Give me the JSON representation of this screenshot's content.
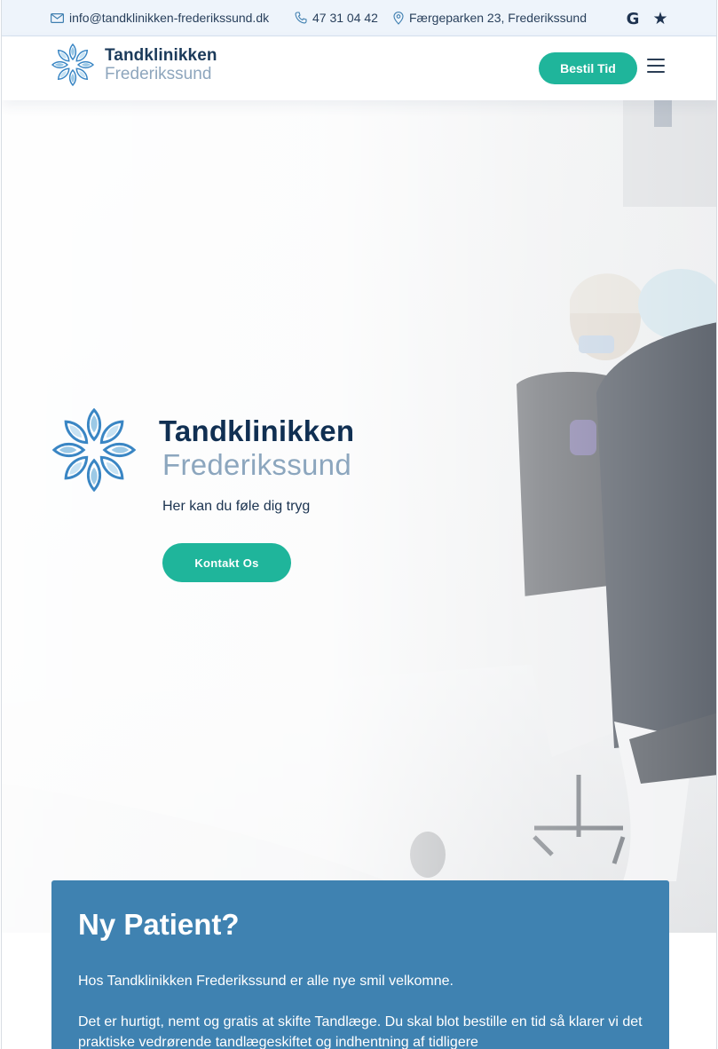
{
  "topbar": {
    "email": "info@tandklinikken-frederikssund.dk",
    "phone": "47 31 04 42",
    "address": "Færgeparken 23, Frederikssund",
    "social": {
      "google_label": "G",
      "review_label": "★"
    }
  },
  "header": {
    "logo_line1": "Tandklinikken",
    "logo_line2": "Frederikssund",
    "book_button": "Bestil Tid"
  },
  "hero": {
    "logo_line1": "Tandklinikken",
    "logo_line2": "Frederikssund",
    "tagline": "Her kan du føle dig tryg",
    "contact_button": "Kontakt Os"
  },
  "new_patient": {
    "title": "Ny Patient?",
    "paragraph1": "Hos Tandklinikken Frederikssund er alle nye smil velkomne.",
    "paragraph2": "Det er hurtigt, nemt og gratis at skifte Tandlæge. Du skal blot bestille en tid så klarer vi det praktiske vedrørende tandlægeskiftet og indhentning af tidligere"
  },
  "colors": {
    "accent": "#1fb59b",
    "navy": "#102f52",
    "brand_light": "#8ca6be",
    "card": "#3f82b1",
    "topbar_bg": "#eef4fb"
  },
  "icons": [
    "mail-icon",
    "phone-icon",
    "location-pin-icon",
    "google-icon",
    "star-icon",
    "menu-icon",
    "flower-logo-icon"
  ]
}
